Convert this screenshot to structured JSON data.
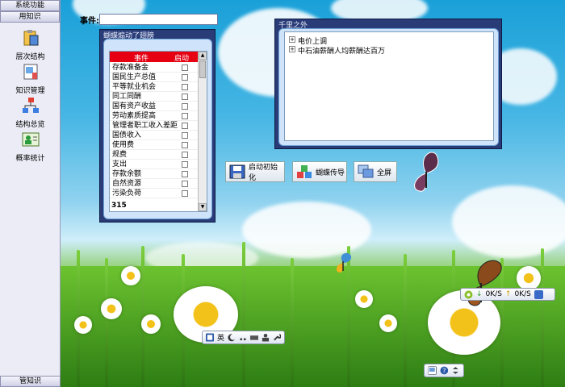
{
  "sidebar": {
    "top_header": "系统功能",
    "section_header": "用知识",
    "items": [
      {
        "label": "层次结构",
        "icon": "clipboard-icon"
      },
      {
        "label": "知识管理",
        "icon": "notebook-icon"
      },
      {
        "label": "结构总览",
        "icon": "hierarchy-icon"
      },
      {
        "label": "概率统计",
        "icon": "person-card-icon"
      }
    ],
    "bottom_header": "管知识"
  },
  "event": {
    "label": "事件:",
    "value": ""
  },
  "left_panel": {
    "title": "蝴蝶煽动了翅膀",
    "columns": [
      "事件",
      "启动"
    ],
    "rows": [
      "存款准备金",
      "国民生产总值",
      "平等就业机会",
      "同工同酬",
      "国有资产收益",
      "劳动素质提高",
      "管理者职工收入差距",
      "国债收入",
      "使用费",
      "规费",
      "支出",
      "存款余额",
      "自然资源",
      "污染负荷"
    ],
    "count": "315"
  },
  "right_panel": {
    "title": "千里之外",
    "tree": [
      {
        "expander": "+",
        "label": "电价上调"
      },
      {
        "expander": "+",
        "label": "中石油薪酬人均薪酬达百万"
      }
    ]
  },
  "buttons": {
    "init": "启动初始化",
    "propagate": "蝴蝶传导",
    "fullscreen": "全屏"
  },
  "ime_bar": {
    "lang": "英"
  },
  "net_bar": {
    "down": "0K/S",
    "up": "0K/S"
  },
  "colors": {
    "header_red": "#e60012",
    "panel_blue": "#2a3c78"
  }
}
